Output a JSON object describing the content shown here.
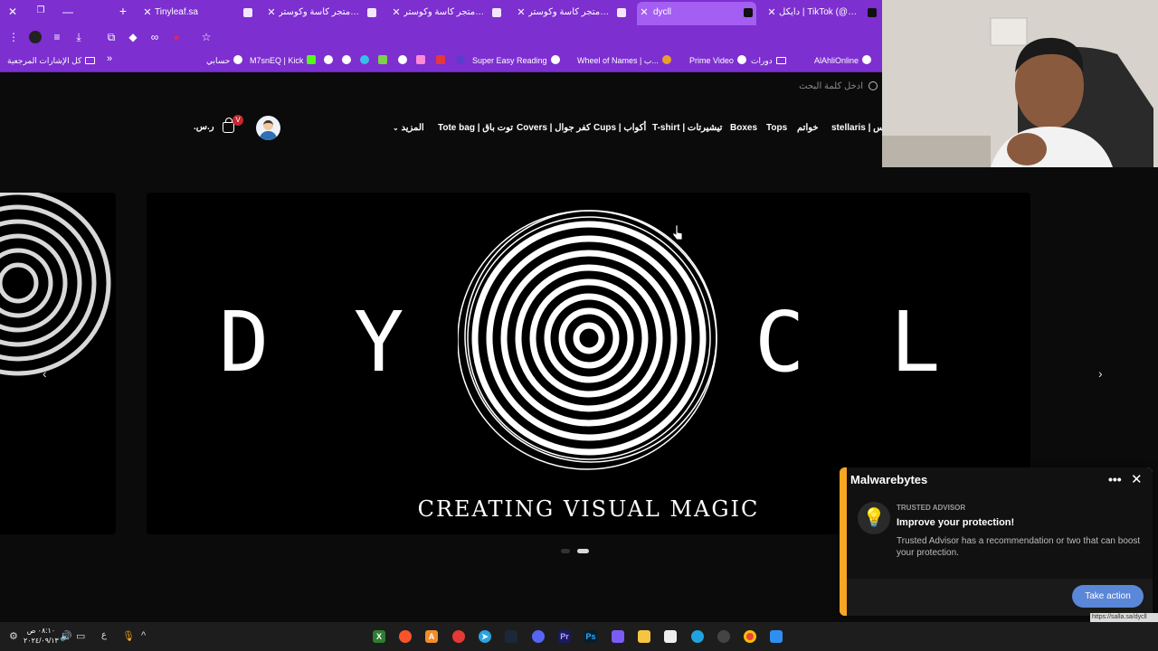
{
  "browser": {
    "tabs": [
      {
        "title": "Tinyleaf.sa",
        "active": false
      },
      {
        "title": "أدوات قهوة - متجر كاسة وكوستر",
        "active": false
      },
      {
        "title": "كوسترات - متجر كاسة وكوستر",
        "active": false
      },
      {
        "title": "أكواب قهوة - متجر كاسة وكوستر",
        "active": false
      },
      {
        "title": "dycll",
        "active": true
      },
      {
        "title": "دايكل | TikTok (@dy.cl_)",
        "active": false
      }
    ],
    "new_tab_symbol": "+",
    "bookmarks": [
      {
        "label": "كل الإشارات المرجعية",
        "icon": "folder-icon"
      },
      {
        "label": "حسابي",
        "icon": "globe-icon"
      },
      {
        "label": "M7snEQ | Kick",
        "icon": "kick-icon"
      },
      {
        "label": "Super Easy Reading",
        "icon": "globe-icon"
      },
      {
        "label": "Wheel of Names | ب...",
        "icon": "globe-icon"
      },
      {
        "label": "Prime Video",
        "icon": "prime-icon"
      },
      {
        "label": "دورات",
        "icon": "globe-icon"
      },
      {
        "label": "AlAhliOnline",
        "icon": "globe-icon"
      }
    ],
    "bookmarks_overflow": "»"
  },
  "site": {
    "search_placeholder": "ادخل كلمة البحث",
    "nav": [
      {
        "label": "stellaris | يس"
      },
      {
        "label": "خواتم"
      },
      {
        "label": "Tops"
      },
      {
        "label": "Boxes"
      },
      {
        "label": "T-shirt | تيشيرتات"
      },
      {
        "label": "Cups | أكواب"
      },
      {
        "label": "Covers | كفر جوال"
      },
      {
        "label": "Tote bag | توت باق"
      },
      {
        "label": "المزيد"
      }
    ],
    "cart_count": "V",
    "cart_total": ".ر.س",
    "hero": {
      "letters": [
        "D",
        "Y",
        "C",
        "L"
      ],
      "tagline": "CREATING VISUAL MAGIC",
      "prev_arrow": "‹",
      "next_arrow": "›"
    }
  },
  "malwarebytes": {
    "brand": "Malwarebytes",
    "kicker": "TRUSTED ADVISOR",
    "title": "Improve your protection!",
    "description": "Trusted Advisor has a recommendation or two that can boost your protection.",
    "action": "Take action",
    "more": "•••",
    "close": "✕"
  },
  "status_url": "https://salla.sa/dycll",
  "taskbar": {
    "time": "٠٨:١٠ ص",
    "date": "٢٠٢٤/٠٩/١٣",
    "lang": "ع"
  },
  "colors": {
    "chrome": "#7d2fd0",
    "active_tab": "#a45ef2",
    "mb_accent": "#f6a623",
    "mb_button": "#5a87d8"
  }
}
